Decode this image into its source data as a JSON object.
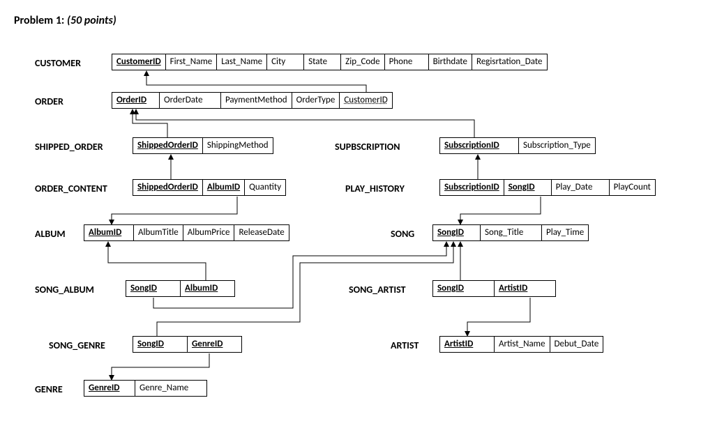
{
  "title_prefix": "Problem 1:",
  "title_points": "(50 points)",
  "entities": {
    "customer": {
      "label": "CUSTOMER",
      "cols": [
        "CustomerID",
        "First_Name",
        "Last_Name",
        "City",
        "State",
        "Zip_Code",
        "Phone",
        "Birthdate",
        "Regisrtation_Date"
      ]
    },
    "order": {
      "label": "ORDER",
      "cols": [
        "OrderID",
        "OrderDate",
        "PaymentMethod",
        "OrderType",
        "CustomerID"
      ]
    },
    "shipped_order": {
      "label": "SHIPPED_ORDER",
      "cols": [
        "ShippedOrderID",
        "ShippingMethod"
      ]
    },
    "subscription": {
      "label": "SUPBSCRIPTION",
      "cols": [
        "SubscriptionID",
        "Subscription_Type"
      ]
    },
    "order_content": {
      "label": "ORDER_CONTENT",
      "cols": [
        "ShippedOrderID",
        "AlbumID",
        "Quantity"
      ]
    },
    "play_history": {
      "label": "PLAY_HISTORY",
      "cols": [
        "SubscriptionID",
        "SongID",
        "Play_Date",
        "PlayCount"
      ]
    },
    "album": {
      "label": "ALBUM",
      "cols": [
        "AlbumID",
        "AlbumTitle",
        "AlbumPrice",
        "ReleaseDate"
      ]
    },
    "song": {
      "label": "SONG",
      "cols": [
        "SongID",
        "Song_Title",
        "Play_Time"
      ]
    },
    "song_album": {
      "label": "SONG_ALBUM",
      "cols": [
        "SongID",
        "AlbumID"
      ]
    },
    "song_artist": {
      "label": "SONG_ARTIST",
      "cols": [
        "SongID",
        "ArtistID"
      ]
    },
    "song_genre": {
      "label": "SONG_GENRE",
      "cols": [
        "SongID",
        "GenreID"
      ]
    },
    "artist": {
      "label": "ARTIST",
      "cols": [
        "ArtistID",
        "Artist_Name",
        "Debut_Date"
      ]
    },
    "genre": {
      "label": "GENRE",
      "cols": [
        "GenreID",
        "Genre_Name"
      ]
    }
  }
}
